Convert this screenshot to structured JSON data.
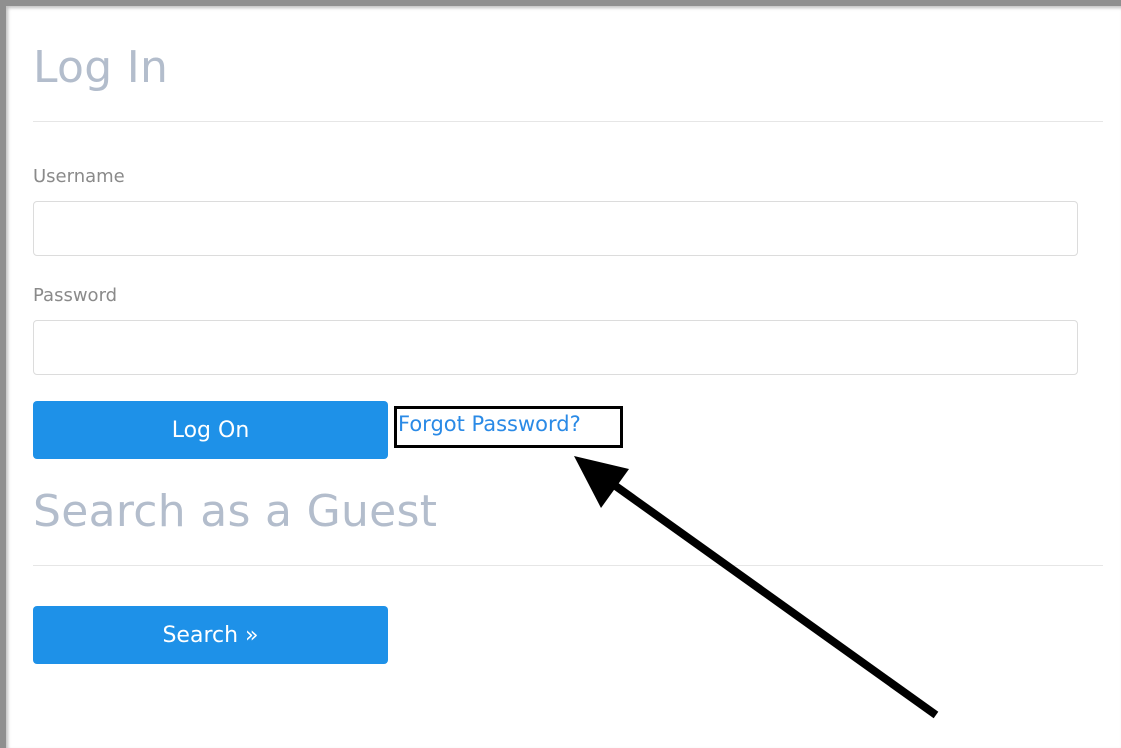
{
  "login": {
    "title": "Log In",
    "username_label": "Username",
    "username_value": "",
    "password_label": "Password",
    "password_value": "",
    "logon_button_label": "Log On",
    "forgot_password_link": "Forgot Password?"
  },
  "guest": {
    "title": "Search as a Guest",
    "search_button_label": "Search »"
  },
  "annotation": {
    "callout_target": "forgot-password-link",
    "arrow_icon": "arrow-pointer-icon"
  },
  "colors": {
    "heading": "#b3bdcc",
    "primary_button": "#1e91e8",
    "link": "#2a8ae6",
    "label": "#8a8a8a",
    "callout": "#000000"
  }
}
